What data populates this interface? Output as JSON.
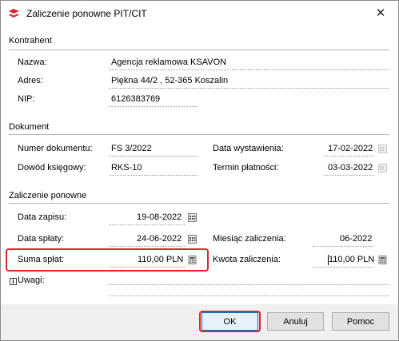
{
  "window": {
    "title": "Zaliczenie ponowne PIT/CIT",
    "close_glyph": "✕"
  },
  "kontrahent": {
    "header": "Kontrahent",
    "nazwa_label": "Nazwa:",
    "nazwa_value": "Agencja reklamowa KSAVON",
    "adres_label": "Adres:",
    "adres_value": "Piękna  44/2 , 52-365 Koszalin",
    "nip_label": "NIP:",
    "nip_value": "6126383769"
  },
  "dokument": {
    "header": "Dokument",
    "numer_label": "Numer dokumentu:",
    "numer_value": "FS 3/2022",
    "dowod_label": "Dowód księgowy:",
    "dowod_value": "RKS-10",
    "data_wyst_label": "Data wystawienia:",
    "data_wyst_value": "17-02-2022",
    "termin_label": "Termin płatności:",
    "termin_value": "03-03-2022"
  },
  "zaliczenie": {
    "header": "Zaliczenie ponowne",
    "data_zapisu_label": "Data zapisu:",
    "data_zapisu_value": "19-08-2022",
    "data_splaty_label": "Data spłaty:",
    "data_splaty_value": "24-06-2022",
    "miesiac_label": "Miesiąc zaliczenia:",
    "miesiac_value": "06-2022",
    "suma_label": "Suma spłat:",
    "suma_value": "110,00 PLN",
    "kwota_label": "Kwota zaliczenia:",
    "kwota_value": "110,00 PLN",
    "uwagi_label": "Uwagi:"
  },
  "buttons": {
    "ok": "OK",
    "anuluj": "Anuluj",
    "pomoc": "Pomoc"
  },
  "colors": {
    "highlight": "#e0262a",
    "disabled_icon": "#c8c8c8"
  }
}
